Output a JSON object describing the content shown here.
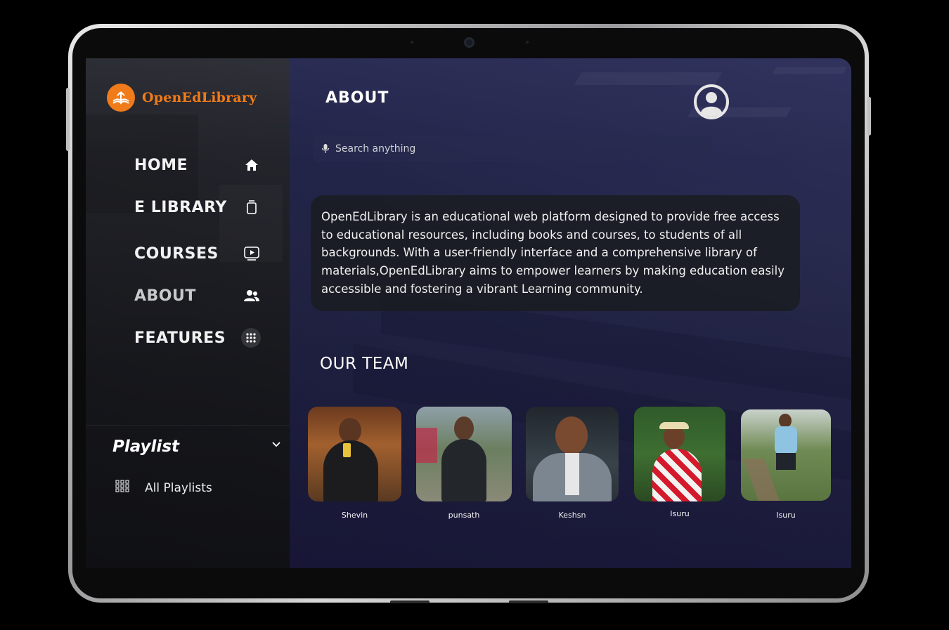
{
  "app": {
    "brand": "OpenEdLibrary",
    "page_title": "ABOUT"
  },
  "sidebar": {
    "items": [
      {
        "label": "HOME",
        "icon": "home-icon"
      },
      {
        "label": "E LIBRARY",
        "icon": "book-icon"
      },
      {
        "label": "COURSES",
        "icon": "video-play-icon"
      },
      {
        "label": "ABOUT",
        "icon": "users-icon",
        "active": true
      },
      {
        "label": "FEATURES",
        "icon": "grid-icon"
      }
    ],
    "playlist": {
      "title": "Playlist",
      "items": [
        {
          "label": "All Playlists",
          "icon": "grid-small-icon"
        }
      ]
    }
  },
  "search": {
    "placeholder": "Search anything"
  },
  "about": {
    "text": "OpenEdLibrary is an educational web platform designed to provide free access\nto educational resources, including books and courses, to students of all\nbackgrounds. With a user-friendly interface and a comprehensive library of\nmaterials,OpenEdLibrary aims to empower learners by  making education easily\naccessible and fostering a vibrant  Learning community."
  },
  "team": {
    "title": "OUR TEAM",
    "members": [
      {
        "name": "Shevin"
      },
      {
        "name": "punsath"
      },
      {
        "name": "Keshsn"
      },
      {
        "name": "Isuru"
      },
      {
        "name": "Isuru"
      }
    ]
  },
  "colors": {
    "brand_orange": "#f07b1a",
    "main_overlay": "#23235f",
    "card_bg": "#1a1c22"
  }
}
